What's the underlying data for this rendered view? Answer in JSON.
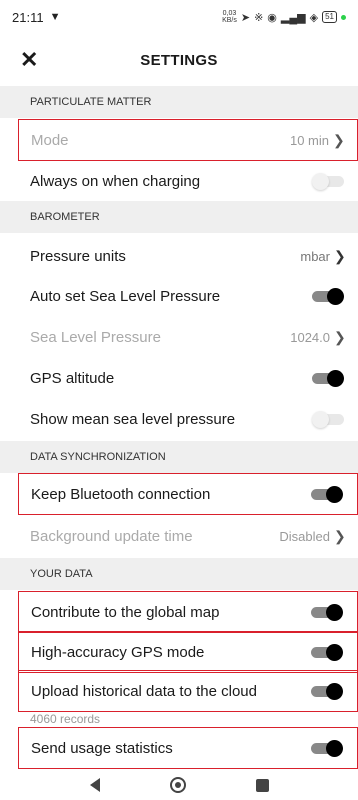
{
  "status": {
    "time": "21:11",
    "net_speed": "0,03\nKB/s",
    "battery": "51"
  },
  "appbar": {
    "title": "SETTINGS"
  },
  "sections": {
    "pm": "PARTICULATE MATTER",
    "barometer": "BAROMETER",
    "sync": "DATA SYNCHRONIZATION",
    "yourdata": "YOUR DATA"
  },
  "rows": {
    "mode": {
      "label": "Mode",
      "value": "10 min"
    },
    "always_on": {
      "label": "Always on when charging",
      "on": false
    },
    "pressure_units": {
      "label": "Pressure units",
      "value": "mbar"
    },
    "auto_slp": {
      "label": "Auto set Sea Level Pressure",
      "on": true
    },
    "slp": {
      "label": "Sea Level Pressure",
      "value": "1024.0"
    },
    "gps_alt": {
      "label": "GPS altitude",
      "on": true
    },
    "show_mslp": {
      "label": "Show mean sea level pressure",
      "on": false
    },
    "keep_bt": {
      "label": "Keep Bluetooth connection",
      "on": true
    },
    "bg_update": {
      "label": "Background update time",
      "value": "Disabled"
    },
    "contribute": {
      "label": "Contribute to the global map",
      "on": true
    },
    "hi_gps": {
      "label": "High-accuracy GPS mode",
      "on": true
    },
    "upload": {
      "label": "Upload historical data to the cloud",
      "on": true,
      "sub": "4060 records"
    },
    "usage": {
      "label": "Send usage statistics",
      "on": true
    }
  },
  "icons": {
    "close": "close-icon",
    "chevron": "chevron-right-icon",
    "back": "back-icon",
    "home": "home-icon",
    "recents": "recents-icon"
  },
  "colors": {
    "highlight": "#d9202c",
    "toggle_on": "#000000",
    "section_bg": "#efefef"
  }
}
